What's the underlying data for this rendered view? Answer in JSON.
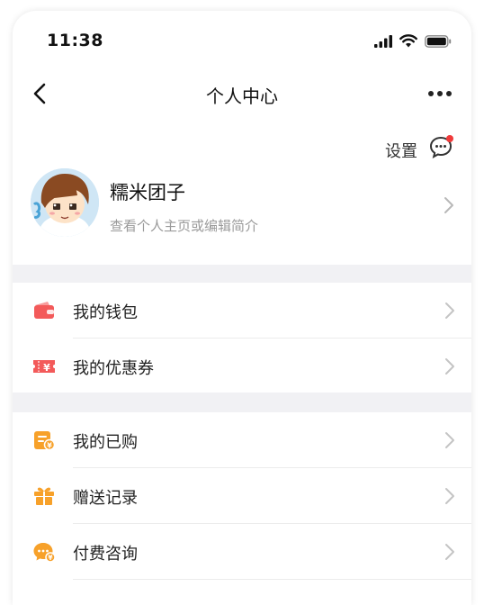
{
  "status_bar": {
    "time": "11:38",
    "icons": [
      "signal-icon",
      "wifi-icon",
      "battery-icon"
    ]
  },
  "nav": {
    "title": "个人中心",
    "back_icon": "chevron-left-icon",
    "more_icon": "more-dots-icon"
  },
  "header_actions": {
    "settings_label": "设置",
    "message_icon": "chat-bubble-icon",
    "message_badge_color": "#f03a3a"
  },
  "profile": {
    "name": "糯米团子",
    "subtitle": "查看个人主页或编辑简介"
  },
  "menu_group_1": [
    {
      "label": "我的钱包",
      "icon": "wallet-icon",
      "color": "#f35a5a"
    },
    {
      "label": "我的优惠券",
      "icon": "coupon-icon",
      "color": "#f35a5a"
    }
  ],
  "menu_group_2": [
    {
      "label": "我的已购",
      "icon": "purchased-icon",
      "color": "#f7a12a"
    },
    {
      "label": "赠送记录",
      "icon": "gift-icon",
      "color": "#f7a12a"
    },
    {
      "label": "付费咨询",
      "icon": "paid-consult-icon",
      "color": "#f7a12a"
    }
  ],
  "colors": {
    "accent_red": "#f35a5a",
    "accent_orange": "#f7a12a",
    "page_bg": "#f1f1f4"
  }
}
